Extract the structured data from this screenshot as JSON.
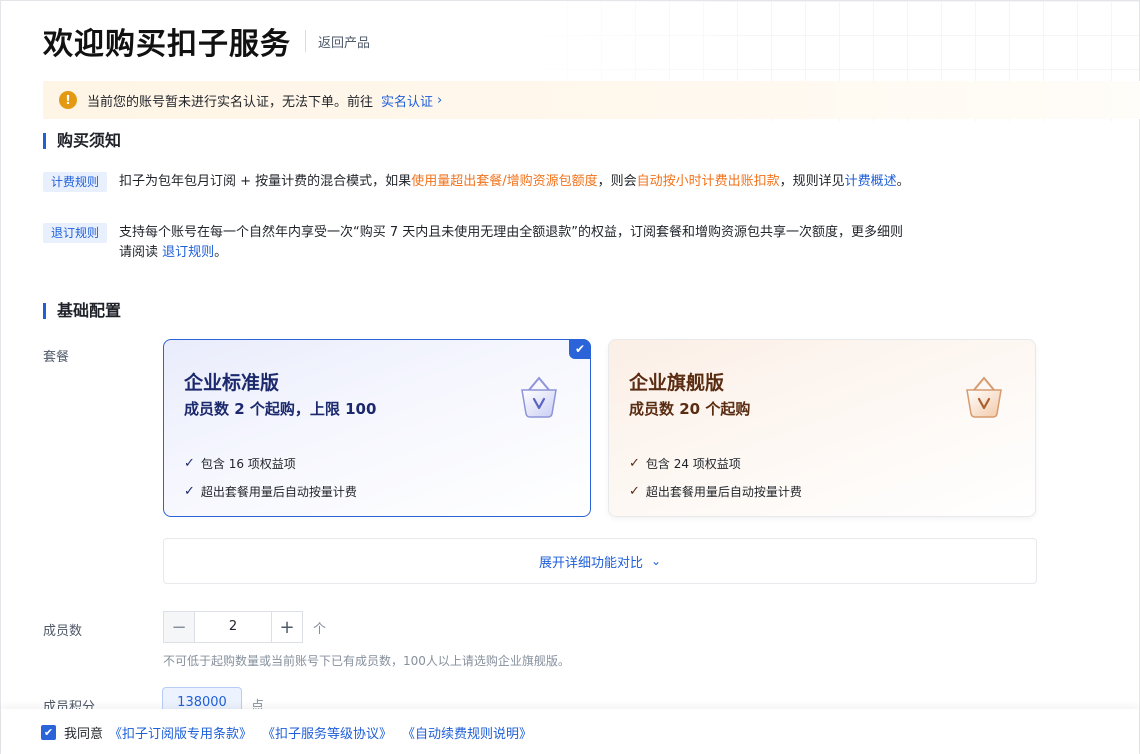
{
  "header": {
    "title": "欢迎购买扣子服务",
    "back_label": "返回产品"
  },
  "alert": {
    "icon": "warning-icon",
    "text": "当前您的账号暂未进行实名认证，无法下单。前往",
    "link": "实名认证",
    "chevron": "›"
  },
  "notice_section": {
    "title": "购买须知",
    "billing": {
      "tag": "计费规则",
      "text_1": "扣子为包年包月订阅 + 按量计费的混合模式，如果",
      "highlight_1": "使用量超出套餐/增购资源包额度",
      "text_2": "，则会",
      "highlight_2": "自动按小时计费出账扣款",
      "text_3": "，规则详见",
      "link": "计费概述",
      "end": "。"
    },
    "refund": {
      "tag": "退订规则",
      "text": "支持每个账号在每一个自然年内享受一次“购买 7 天内且未使用无理由全额退款”的权益，订阅套餐和增购资源包共享一次额度，更多细则请阅读 ",
      "link": "退订规则",
      "end": "。"
    }
  },
  "config_section": {
    "title": "基础配置",
    "plan_label": "套餐",
    "plans": [
      {
        "name": "企业标准版",
        "desc": "成员数 2 个起购，上限 100",
        "features": [
          "包含 16 项权益项",
          "超出套餐用量后自动按量计费"
        ],
        "selected": true,
        "icon": "basket-icon"
      },
      {
        "name": "企业旗舰版",
        "desc": "成员数 20 个起购",
        "features": [
          "包含 24 项权益项",
          "超出套餐用量后自动按量计费"
        ],
        "selected": false,
        "icon": "basket-icon"
      }
    ],
    "expand_label": "展开详细功能对比",
    "members_label": "成员数",
    "members_value": "2",
    "members_unit": "个",
    "members_hint": "不可低于起购数量或当前账号下已有成员数，100人以上请选购企业旗舰版。",
    "points_label": "成员积分",
    "points_value": "138000",
    "points_unit": "点"
  },
  "footer": {
    "agree_text": "我同意",
    "links": [
      "《扣子订阅版专用条款》",
      "《扣子服务等级协议》",
      "《自动续费规则说明》"
    ]
  },
  "colors": {
    "accent": "#1f5fd8",
    "orange": "#f2731c",
    "warning": "#e39a12"
  }
}
